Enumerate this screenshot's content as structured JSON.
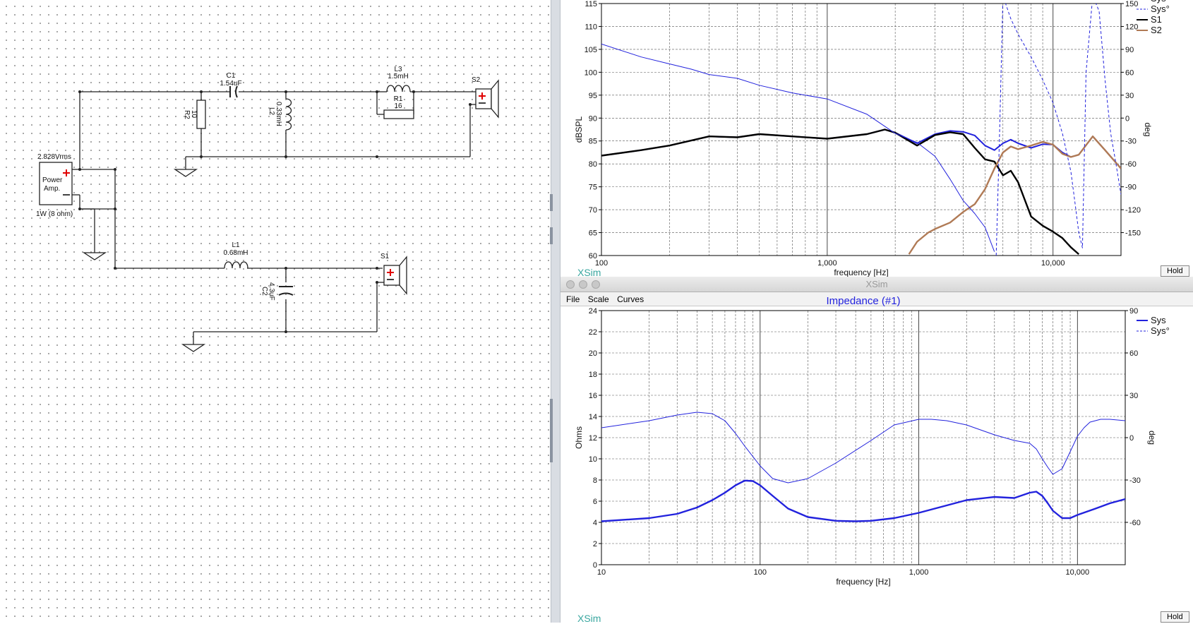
{
  "schematic": {
    "source": {
      "label": "2.828Vrms",
      "name": "Power\nAmp.",
      "rating": "1W (8 ohm)"
    },
    "components": [
      {
        "id": "C1",
        "value": "1.54uF"
      },
      {
        "id": "R2",
        "value": "10"
      },
      {
        "id": "L2",
        "value": "0.33mH"
      },
      {
        "id": "L3",
        "value": "1.5mH"
      },
      {
        "id": "R1",
        "value": "16"
      },
      {
        "id": "S2",
        "value": ""
      },
      {
        "id": "L1",
        "value": "0.68mH"
      },
      {
        "id": "C2",
        "value": "4.3uF"
      },
      {
        "id": "S1",
        "value": ""
      }
    ]
  },
  "spl_window": {
    "xlabel": "frequency [Hz]",
    "ylabel": "dBSPL",
    "y2label": "deg",
    "ghost_title": "XSim",
    "hold_label": "Hold",
    "legend": [
      {
        "name": "Sys°",
        "color": "#2222dd",
        "style": "dashed"
      },
      {
        "name": "S1",
        "color": "#000000",
        "style": "solid"
      },
      {
        "name": "S2",
        "color": "#b07a55",
        "style": "solid"
      }
    ]
  },
  "impedance_window": {
    "window_title": "XSim",
    "menu": [
      "File",
      "Scale",
      "Curves"
    ],
    "hold_label": "Hold",
    "ghost_title": "XSim"
  },
  "chart_data": [
    {
      "type": "line",
      "title": "",
      "xlabel": "frequency [Hz]",
      "ylabel": "dBSPL",
      "y2label": "deg",
      "xscale": "log",
      "xlim": [
        100,
        20000
      ],
      "ylim": [
        60,
        115
      ],
      "y2lim": [
        -180,
        150
      ],
      "xticks": [
        {
          "v": 100,
          "label": "100"
        },
        {
          "v": 1000,
          "label": "1,000"
        },
        {
          "v": 10000,
          "label": "10,000"
        }
      ],
      "yticks": [
        60,
        65,
        70,
        75,
        80,
        85,
        90,
        95,
        100,
        105,
        110,
        115
      ],
      "y2ticks": [
        -150,
        -120,
        -90,
        -60,
        -30,
        0,
        30,
        60,
        90,
        120,
        150
      ],
      "grid": true,
      "legend_position": "top-right outside",
      "series": [
        {
          "name": "Sys",
          "axis": "left",
          "color": "#2222dd",
          "width": 2,
          "dash": false,
          "x": [
            100,
            150,
            200,
            300,
            400,
            500,
            700,
            1000,
            1500,
            1800,
            2000,
            2500,
            3000,
            3500,
            4000,
            4500,
            5000,
            5500,
            6000,
            6500,
            7000,
            8000,
            9000,
            10000,
            11000,
            12000,
            13000,
            15000,
            17000,
            20000
          ],
          "y": [
            81.8,
            83,
            84,
            86,
            85.8,
            86.5,
            86,
            85.5,
            86.5,
            87.5,
            86.8,
            84.5,
            86.5,
            87.2,
            87,
            86.2,
            84,
            83,
            84.5,
            85.3,
            84.5,
            83.5,
            84.3,
            84.2,
            82.5,
            81.5,
            82,
            86,
            83,
            79
          ]
        },
        {
          "name": "S1",
          "axis": "left",
          "color": "#000000",
          "width": 2.4,
          "dash": false,
          "x": [
            100,
            150,
            200,
            300,
            400,
            500,
            700,
            1000,
            1500,
            1800,
            2000,
            2500,
            3000,
            3500,
            4000,
            4500,
            5000,
            5500,
            6000,
            6500,
            7000,
            8000,
            9000,
            10000,
            11000,
            12000,
            13000
          ],
          "y": [
            81.8,
            83,
            84,
            86,
            85.8,
            86.5,
            86,
            85.5,
            86.5,
            87.5,
            86.8,
            84,
            86.3,
            86.9,
            86.5,
            83.5,
            81,
            80.5,
            77.5,
            78.5,
            76,
            68.5,
            66.5,
            65.2,
            63.8,
            61.8,
            60.3
          ]
        },
        {
          "name": "S2",
          "axis": "left",
          "color": "#b07a55",
          "width": 2.4,
          "dash": false,
          "x": [
            2300,
            2500,
            2800,
            3000,
            3500,
            4000,
            4500,
            5000,
            5500,
            6000,
            6500,
            7000,
            8000,
            9000,
            10000,
            11000,
            12000,
            13000,
            15000,
            17000,
            20000
          ],
          "y": [
            60.3,
            63,
            65,
            65.8,
            67.2,
            69.5,
            71.2,
            74.5,
            79,
            82.5,
            83.8,
            83.2,
            84,
            84.8,
            84.2,
            82.2,
            81.5,
            82,
            86,
            83,
            79
          ]
        },
        {
          "name": "Sys°",
          "axis": "right",
          "color": "#2222dd",
          "width": 1,
          "dash": true,
          "x": [
            5600,
            5800,
            6000,
            6500,
            7000,
            8000,
            9000,
            10000,
            11000,
            12000,
            12500,
            13000,
            13500,
            14000,
            15000,
            16000,
            17000,
            18000,
            19000,
            20000
          ],
          "y": [
            -180,
            -20,
            160,
            130,
            110,
            80,
            50,
            20,
            -20,
            -70,
            -110,
            -150,
            -170,
            60,
            160,
            140,
            50,
            -20,
            -60,
            -100
          ]
        },
        {
          "name": "Sys° (S1 phase)",
          "axis": "right",
          "color": "#2222dd",
          "width": 1,
          "dash": false,
          "x": [
            100,
            150,
            200,
            250,
            300,
            400,
            500,
            700,
            1000,
            1500,
            2000,
            2500,
            3000,
            3500,
            4000,
            4500,
            5000,
            5500
          ],
          "y": [
            97,
            80,
            71,
            64,
            57,
            52,
            43,
            33,
            25,
            5,
            -20,
            -32,
            -50,
            -80,
            -108,
            -125,
            -143,
            -175
          ]
        }
      ]
    },
    {
      "type": "line",
      "title": "Impedance (#1)",
      "xlabel": "frequency [Hz]",
      "ylabel": "Ohms",
      "y2label": "deg",
      "xscale": "log",
      "xlim": [
        10,
        20000
      ],
      "ylim": [
        0,
        24
      ],
      "y2lim": [
        -90,
        90
      ],
      "xticks": [
        {
          "v": 10,
          "label": "10"
        },
        {
          "v": 100,
          "label": "100"
        },
        {
          "v": 1000,
          "label": "1,000"
        },
        {
          "v": 10000,
          "label": "10,000"
        }
      ],
      "yticks": [
        0,
        2,
        4,
        6,
        8,
        10,
        12,
        14,
        16,
        18,
        20,
        22,
        24
      ],
      "y2ticks": [
        -60,
        -30,
        0,
        30,
        60,
        90
      ],
      "grid": true,
      "legend_position": "top-right outside",
      "legend": [
        {
          "name": "Sys",
          "color": "#2222dd",
          "style": "solid"
        },
        {
          "name": "Sys°",
          "color": "#2222dd",
          "style": "dashed"
        }
      ],
      "series": [
        {
          "name": "Sys",
          "axis": "left",
          "color": "#2222dd",
          "width": 2.4,
          "dash": false,
          "x": [
            10,
            20,
            30,
            40,
            50,
            60,
            70,
            80,
            90,
            100,
            120,
            150,
            200,
            300,
            400,
            500,
            700,
            1000,
            1500,
            2000,
            3000,
            4000,
            5000,
            5500,
            6000,
            6500,
            7000,
            8000,
            9000,
            10000,
            13000,
            16000,
            20000
          ],
          "y": [
            4.1,
            4.4,
            4.8,
            5.4,
            6.1,
            6.8,
            7.5,
            7.95,
            7.9,
            7.5,
            6.5,
            5.3,
            4.5,
            4.15,
            4.1,
            4.15,
            4.4,
            4.9,
            5.6,
            6.1,
            6.4,
            6.3,
            6.8,
            6.9,
            6.5,
            5.8,
            5.1,
            4.4,
            4.4,
            4.7,
            5.3,
            5.8,
            6.2
          ]
        },
        {
          "name": "Sys°",
          "axis": "right",
          "color": "#2222dd",
          "width": 1,
          "dash": false,
          "x": [
            10,
            20,
            30,
            40,
            50,
            60,
            70,
            80,
            100,
            120,
            150,
            200,
            300,
            500,
            700,
            1000,
            1200,
            1500,
            2000,
            3000,
            4000,
            5000,
            5500,
            6000,
            6500,
            7000,
            8000,
            9000,
            10000,
            11000,
            12000,
            14000,
            16000,
            20000
          ],
          "y": [
            7,
            12,
            16,
            18,
            17,
            12,
            3,
            -6,
            -20,
            -29,
            -32,
            -29,
            -18,
            -2,
            9,
            13,
            13,
            12,
            9,
            2,
            -2,
            -4,
            -8,
            -15,
            -21,
            -26,
            -22,
            -10,
            1,
            7,
            11,
            13,
            13,
            12
          ]
        }
      ]
    }
  ]
}
